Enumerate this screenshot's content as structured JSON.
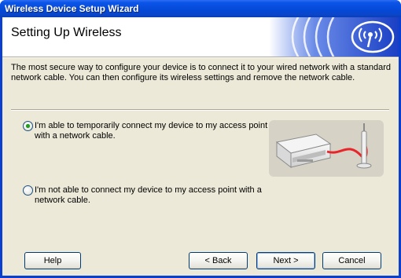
{
  "window": {
    "title": "Wireless Device Setup Wizard"
  },
  "header": {
    "heading": "Setting Up Wireless"
  },
  "intro": "The most secure way to configure your device is to connect it to your wired network with a standard network cable. You can then configure its wireless settings and remove the network cable.",
  "options": [
    {
      "label": "I'm able to temporarily connect my device to my access point with a network cable.",
      "checked": true
    },
    {
      "label": "I'm not able to connect my device to my access point with a network cable.",
      "checked": false
    }
  ],
  "buttons": {
    "help": "Help",
    "back": "< Back",
    "next": "Next >",
    "cancel": "Cancel"
  },
  "colors": {
    "titlebar": "#0a55e8",
    "client_bg": "#ece9d8",
    "radio_dot": "#21a121",
    "header_art": "#2a4fd0",
    "cable": "#e8252a"
  },
  "icons": {
    "header_art": "wireless-waves-logo",
    "illustration": "printer-connected-to-access-point"
  }
}
